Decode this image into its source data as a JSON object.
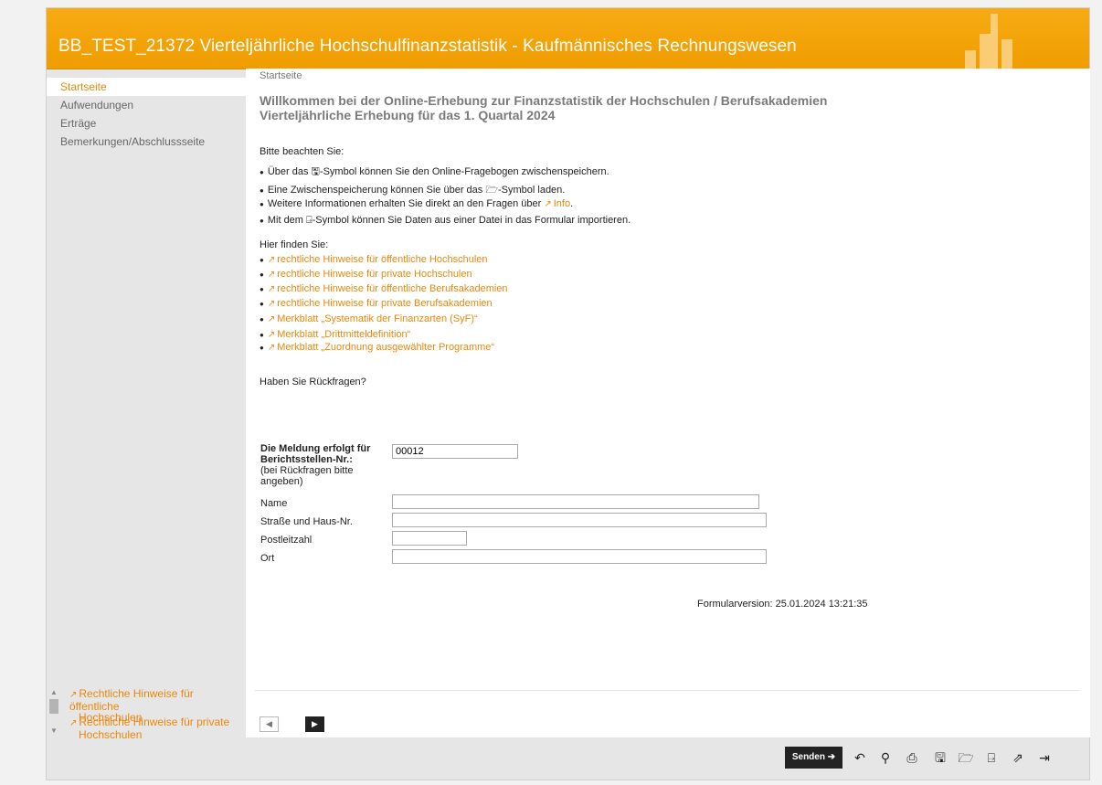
{
  "header": {
    "title": "BB_TEST_21372 Vierteljährliche Hochschulfinanzstatistik - Kaufmännisches Rechnungswesen"
  },
  "sidebar": {
    "items": [
      {
        "label": "Startseite",
        "active": true
      },
      {
        "label": "Aufwendungen"
      },
      {
        "label": "Erträge"
      },
      {
        "label": "Bemerkungen/Abschlussseite"
      }
    ],
    "links": [
      {
        "line1": "Rechtliche Hinweise für öffentliche",
        "line2": "Hochschulen"
      },
      {
        "line1": "Rechtliche Hinweise für private",
        "line2": "Hochschulen"
      }
    ]
  },
  "content": {
    "breadcrumb": "Startseite",
    "heading_line1": "Willkommen bei der Online-Erhebung zur Finanzstatistik der Hochschulen / Berufsakademien",
    "heading_line2": "Vierteljährliche Erhebung für das 1. Quartal 2024",
    "notes_title": "Bitte beachten Sie:",
    "notes": {
      "save_pre": "Über das",
      "save_post": "-Symbol können Sie den Online-Fragebogen zwischenspeichern.",
      "load_pre": "Eine Zwischenspeicherung können Sie über das",
      "load_post": "-Symbol laden.",
      "info_pre": "Weitere Informationen erhalten Sie direkt an den Fragen über",
      "info_link": "Info",
      "import_pre": "Mit dem",
      "import_post": "-Symbol können Sie Daten aus einer Datei in das Formular importieren."
    },
    "find_title": "Hier finden Sie:",
    "find_links": [
      "rechtliche Hinweise für öffentliche Hochschulen",
      "rechtliche Hinweise für private Hochschulen",
      "rechtliche Hinweise für öffentliche Berufsakademien",
      "rechtliche Hinweise für private Berufsakademien",
      "Merkblatt „Systematik der Finanzarten (SyF)“",
      "Merkblatt „Drittmitteldefinition“",
      "Merkblatt „Zuordnung ausgewählter Programme“"
    ],
    "questions": "Haben Sie Rückfragen?",
    "form": {
      "report_label_line1": "Die Meldung erfolgt für",
      "report_label_line2": "Berichtsstellen-Nr.:",
      "report_note_line1": "(bei Rückfragen bitte",
      "report_note_line2": "angeben)",
      "report_value": "00012",
      "name_label": "Name",
      "name_value": "",
      "street_label": "Straße und Haus-Nr.",
      "street_value": "",
      "zip_label": "Postleitzahl",
      "zip_value": "",
      "city_label": "Ort",
      "city_value": ""
    },
    "version": "Formularversion: 25.01.2024 13:21:35"
  },
  "toolbar": {
    "send_label": "Senden",
    "icons": [
      "undo-icon",
      "search-icon",
      "pdf-preview-icon",
      "save-icon",
      "open-folder-icon",
      "import-icon",
      "share-icon",
      "logout-icon"
    ]
  },
  "colors": {
    "header": "#f2a100",
    "accent": "#e9870a",
    "text": "#222222",
    "muted": "#777777"
  }
}
